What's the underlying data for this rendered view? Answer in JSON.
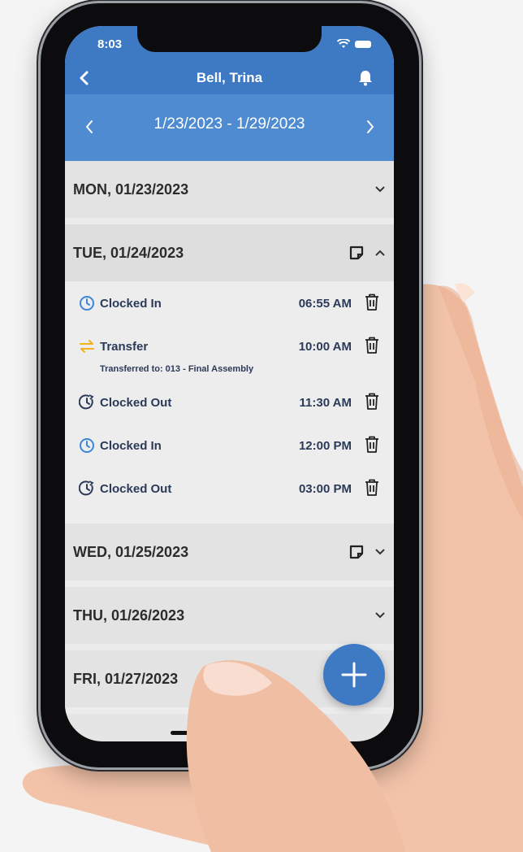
{
  "status": {
    "time": "8:03"
  },
  "nav": {
    "title": "Bell, Trina"
  },
  "week": {
    "range": "1/23/2023 - 1/29/2023"
  },
  "days": [
    {
      "label": "MON, 01/23/2023",
      "has_note": false,
      "expanded": false
    },
    {
      "label": "TUE, 01/24/2023",
      "has_note": true,
      "expanded": true
    },
    {
      "label": "WED, 01/25/2023",
      "has_note": true,
      "expanded": false
    },
    {
      "label": "THU, 01/26/2023",
      "has_note": false,
      "expanded": false
    },
    {
      "label": "FRI, 01/27/2023",
      "has_note": false,
      "expanded": false
    }
  ],
  "entries": [
    {
      "type": "clock-in",
      "label": "Clocked In",
      "time": "06:55 AM",
      "icon": "clock-icon"
    },
    {
      "type": "transfer",
      "label": "Transfer",
      "time": "10:00 AM",
      "icon": "transfer-icon",
      "note": "Transferred to: 013 - Final Assembly"
    },
    {
      "type": "clock-out",
      "label": "Clocked Out",
      "time": "11:30 AM",
      "icon": "clock-out-icon"
    },
    {
      "type": "clock-in",
      "label": "Clocked In",
      "time": "12:00 PM",
      "icon": "clock-icon"
    },
    {
      "type": "clock-out",
      "label": "Clocked Out",
      "time": "03:00 PM",
      "icon": "clock-out-icon"
    }
  ],
  "colors": {
    "primary": "#3e79c4",
    "week_bar": "#4f8bd1",
    "clock_in": "#3e86d8",
    "transfer": "#f2b21b",
    "text_dark": "#2b3a58"
  }
}
